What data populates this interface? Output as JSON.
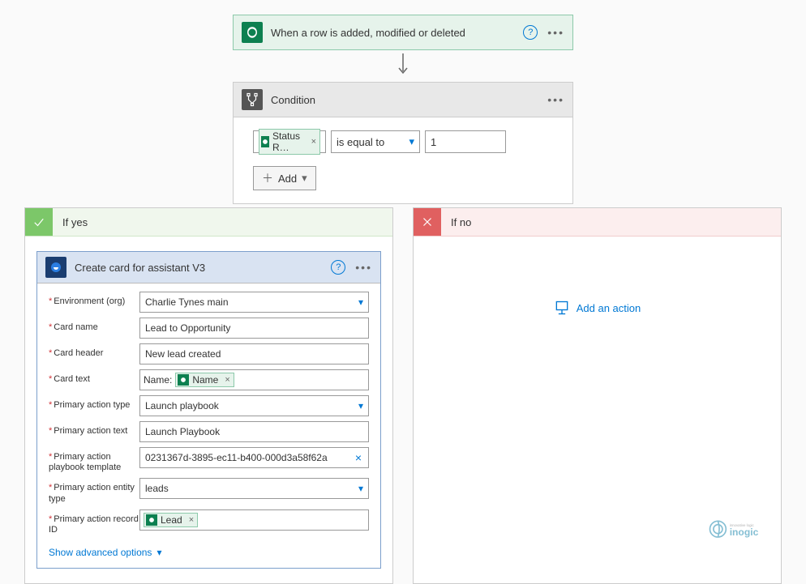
{
  "trigger": {
    "title": "When a row is added, modified or deleted"
  },
  "condition": {
    "title": "Condition",
    "left_token": "Status R…",
    "operator": "is equal to",
    "right_value": "1",
    "add_label": "Add"
  },
  "branches": {
    "yes_label": "If yes",
    "no_label": "If no",
    "add_action_label": "Add an action"
  },
  "action": {
    "title": "Create card for assistant V3",
    "fields": {
      "env": {
        "label": "Environment (org)",
        "value": "Charlie Tynes main"
      },
      "card_name": {
        "label": "Card name",
        "value": "Lead to Opportunity"
      },
      "card_header": {
        "label": "Card header",
        "value": "New lead created"
      },
      "card_text": {
        "label": "Card text",
        "prefix": "Name:",
        "token": "Name"
      },
      "pa_type": {
        "label": "Primary action type",
        "value": "Launch playbook"
      },
      "pa_text": {
        "label": "Primary action text",
        "value": "Launch Playbook"
      },
      "pa_template": {
        "label": "Primary action playbook template",
        "value": "0231367d-3895-ec11-b400-000d3a58f62a"
      },
      "pa_entity": {
        "label": "Primary action entity type",
        "value": "leads"
      },
      "pa_record": {
        "label": "Primary action record ID",
        "token": "Lead"
      }
    },
    "advanced_label": "Show advanced options"
  },
  "watermark": {
    "brand": "inogic",
    "tagline": "innovative logic"
  }
}
